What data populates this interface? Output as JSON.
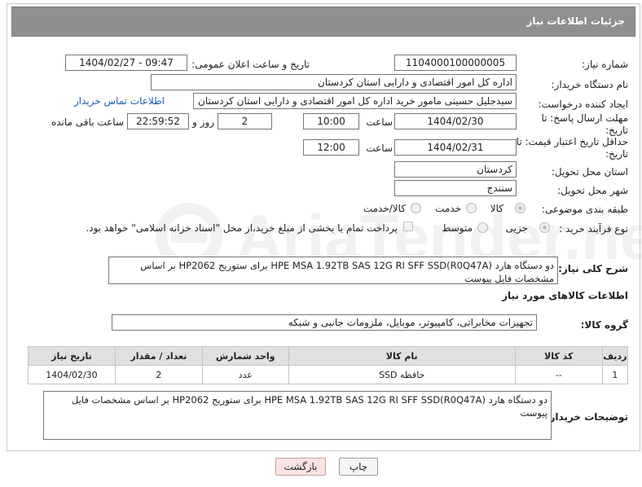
{
  "header": {
    "title": "جزئیات اطلاعات نیاز"
  },
  "watermark": {
    "text": "AriaTender.net"
  },
  "fields": {
    "need_number_label": "شماره نیاز:",
    "need_number": "1104000100000005",
    "announce_label": "تاریخ و ساعت اعلان عمومی:",
    "announce_value": "1404/02/27 - 09:47",
    "buyer_label": "نام دستگاه خریدار:",
    "buyer_value": "اداره کل امور اقتصادی و دارایی استان کردستان",
    "requester_label": "ایجاد کننده درخواست:",
    "requester_value": "سیدجلیل حسینی مامور خرید اداره کل امور اقتصادی و دارایی استان کردستان",
    "contact_link": "اطلاعات تماس خریدار",
    "reply_deadline_label": "مهلت ارسال پاسخ: تا تاریخ:",
    "reply_date": "1404/02/30",
    "time_label": "ساعت",
    "reply_time": "10:00",
    "days_value": "2",
    "days_and_label": "روز و",
    "remaining_value": "22:59:52",
    "remaining_label": "ساعت باقی مانده",
    "price_deadline_label": "حداقل تاریخ اعتبار قیمت: تا تاریخ:",
    "price_date": "1404/02/31",
    "price_time": "12:00",
    "province_label": "استان محل تحویل:",
    "province_value": "کردستان",
    "city_label": "شهر محل تحویل:",
    "city_value": "سنندج",
    "category_label": "طبقه بندی موضوعی:",
    "category_options": [
      "کالا",
      "خدمت",
      "کالا/خدمت"
    ],
    "process_label": "نوع فرآیند خرید :",
    "process_options": [
      "جزیی",
      "متوسط"
    ],
    "payment_note": "پرداخت تمام یا بخشی از مبلغ خرید،از محل \"اسناد خزانه اسلامی\" خواهد بود.",
    "summary_label": "شرح کلی نیاز:",
    "summary_value": "دو دستگاه هارد  HPE MSA 1.92TB SAS 12G RI SFF SSD(R0Q47A)  برای ستوریج HP2062 بر اساس مشخصات فایل پیوست"
  },
  "goods": {
    "section_title": "اطلاعات کالاهای مورد نیاز",
    "group_label": "گروه کالا:",
    "group_value": "تجهیزات مخابراتی، کامپیوتر، موبایل، ملزومات جانبی و شبکه",
    "columns": [
      "ردیف",
      "کد کالا",
      "نام کالا",
      "واحد شمارش",
      "تعداد / مقدار",
      "تاریخ نیاز"
    ],
    "rows": [
      {
        "row": "1",
        "code": "--",
        "name": "حافظه SSD",
        "unit": "عدد",
        "qty": "2",
        "date": "1404/02/30"
      }
    ]
  },
  "buyer_notes": {
    "label": "توضیحات خریدار:",
    "value": "دو دستگاه هارد  HPE MSA 1.92TB SAS 12G RI SFF SSD(R0Q47A)  برای ستوریج HP2062 بر اساس مشخصات فایل پیوست"
  },
  "buttons": {
    "print": "چاپ",
    "back": "بازگشت"
  }
}
